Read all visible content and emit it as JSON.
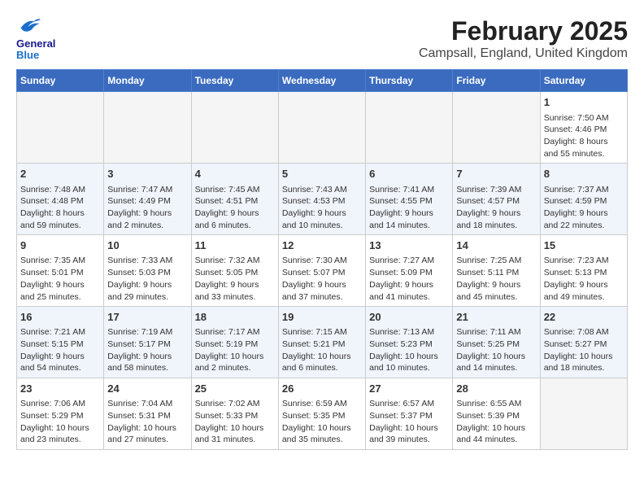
{
  "header": {
    "logo_line1": "General",
    "logo_line2": "Blue",
    "title": "February 2025",
    "subtitle": "Campsall, England, United Kingdom"
  },
  "weekdays": [
    "Sunday",
    "Monday",
    "Tuesday",
    "Wednesday",
    "Thursday",
    "Friday",
    "Saturday"
  ],
  "weeks": [
    [
      {
        "day": "",
        "info": ""
      },
      {
        "day": "",
        "info": ""
      },
      {
        "day": "",
        "info": ""
      },
      {
        "day": "",
        "info": ""
      },
      {
        "day": "",
        "info": ""
      },
      {
        "day": "",
        "info": ""
      },
      {
        "day": "1",
        "info": "Sunrise: 7:50 AM\nSunset: 4:46 PM\nDaylight: 8 hours and 55 minutes."
      }
    ],
    [
      {
        "day": "2",
        "info": "Sunrise: 7:48 AM\nSunset: 4:48 PM\nDaylight: 8 hours and 59 minutes."
      },
      {
        "day": "3",
        "info": "Sunrise: 7:47 AM\nSunset: 4:49 PM\nDaylight: 9 hours and 2 minutes."
      },
      {
        "day": "4",
        "info": "Sunrise: 7:45 AM\nSunset: 4:51 PM\nDaylight: 9 hours and 6 minutes."
      },
      {
        "day": "5",
        "info": "Sunrise: 7:43 AM\nSunset: 4:53 PM\nDaylight: 9 hours and 10 minutes."
      },
      {
        "day": "6",
        "info": "Sunrise: 7:41 AM\nSunset: 4:55 PM\nDaylight: 9 hours and 14 minutes."
      },
      {
        "day": "7",
        "info": "Sunrise: 7:39 AM\nSunset: 4:57 PM\nDaylight: 9 hours and 18 minutes."
      },
      {
        "day": "8",
        "info": "Sunrise: 7:37 AM\nSunset: 4:59 PM\nDaylight: 9 hours and 22 minutes."
      }
    ],
    [
      {
        "day": "9",
        "info": "Sunrise: 7:35 AM\nSunset: 5:01 PM\nDaylight: 9 hours and 25 minutes."
      },
      {
        "day": "10",
        "info": "Sunrise: 7:33 AM\nSunset: 5:03 PM\nDaylight: 9 hours and 29 minutes."
      },
      {
        "day": "11",
        "info": "Sunrise: 7:32 AM\nSunset: 5:05 PM\nDaylight: 9 hours and 33 minutes."
      },
      {
        "day": "12",
        "info": "Sunrise: 7:30 AM\nSunset: 5:07 PM\nDaylight: 9 hours and 37 minutes."
      },
      {
        "day": "13",
        "info": "Sunrise: 7:27 AM\nSunset: 5:09 PM\nDaylight: 9 hours and 41 minutes."
      },
      {
        "day": "14",
        "info": "Sunrise: 7:25 AM\nSunset: 5:11 PM\nDaylight: 9 hours and 45 minutes."
      },
      {
        "day": "15",
        "info": "Sunrise: 7:23 AM\nSunset: 5:13 PM\nDaylight: 9 hours and 49 minutes."
      }
    ],
    [
      {
        "day": "16",
        "info": "Sunrise: 7:21 AM\nSunset: 5:15 PM\nDaylight: 9 hours and 54 minutes."
      },
      {
        "day": "17",
        "info": "Sunrise: 7:19 AM\nSunset: 5:17 PM\nDaylight: 9 hours and 58 minutes."
      },
      {
        "day": "18",
        "info": "Sunrise: 7:17 AM\nSunset: 5:19 PM\nDaylight: 10 hours and 2 minutes."
      },
      {
        "day": "19",
        "info": "Sunrise: 7:15 AM\nSunset: 5:21 PM\nDaylight: 10 hours and 6 minutes."
      },
      {
        "day": "20",
        "info": "Sunrise: 7:13 AM\nSunset: 5:23 PM\nDaylight: 10 hours and 10 minutes."
      },
      {
        "day": "21",
        "info": "Sunrise: 7:11 AM\nSunset: 5:25 PM\nDaylight: 10 hours and 14 minutes."
      },
      {
        "day": "22",
        "info": "Sunrise: 7:08 AM\nSunset: 5:27 PM\nDaylight: 10 hours and 18 minutes."
      }
    ],
    [
      {
        "day": "23",
        "info": "Sunrise: 7:06 AM\nSunset: 5:29 PM\nDaylight: 10 hours and 23 minutes."
      },
      {
        "day": "24",
        "info": "Sunrise: 7:04 AM\nSunset: 5:31 PM\nDaylight: 10 hours and 27 minutes."
      },
      {
        "day": "25",
        "info": "Sunrise: 7:02 AM\nSunset: 5:33 PM\nDaylight: 10 hours and 31 minutes."
      },
      {
        "day": "26",
        "info": "Sunrise: 6:59 AM\nSunset: 5:35 PM\nDaylight: 10 hours and 35 minutes."
      },
      {
        "day": "27",
        "info": "Sunrise: 6:57 AM\nSunset: 5:37 PM\nDaylight: 10 hours and 39 minutes."
      },
      {
        "day": "28",
        "info": "Sunrise: 6:55 AM\nSunset: 5:39 PM\nDaylight: 10 hours and 44 minutes."
      },
      {
        "day": "",
        "info": ""
      }
    ]
  ]
}
